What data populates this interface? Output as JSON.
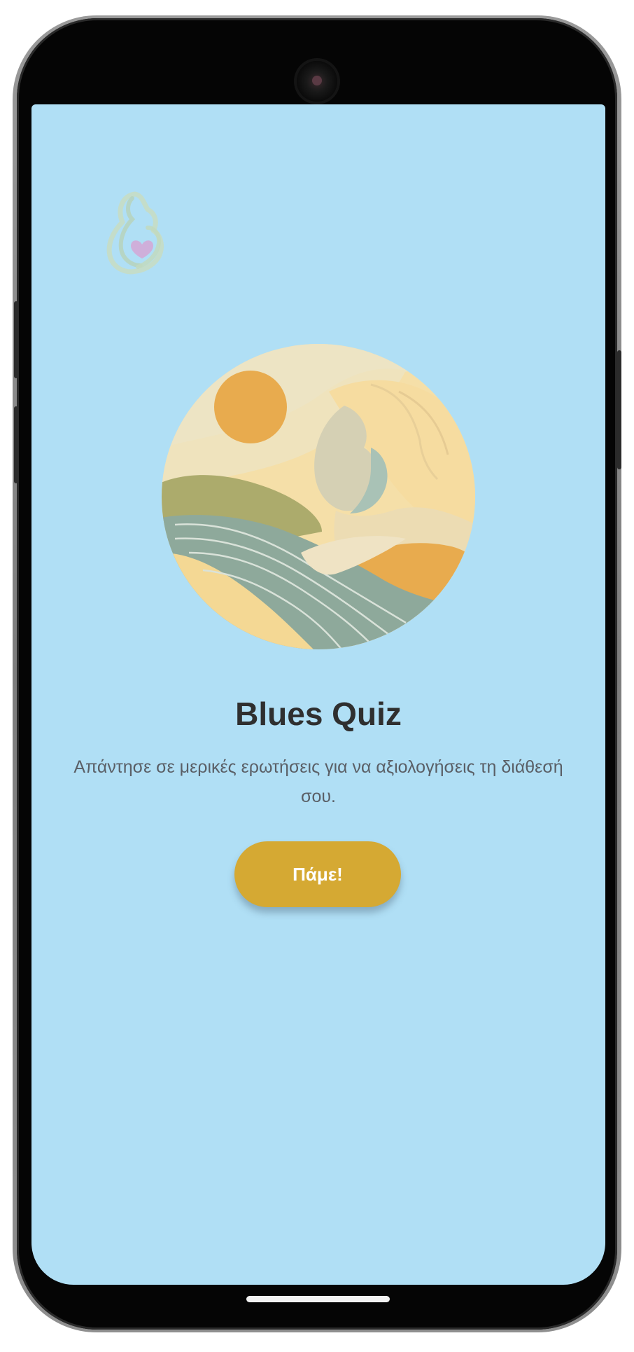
{
  "screen": {
    "background_color": "#b0dff5",
    "logo": {
      "icon": "mother-heart-logo-icon"
    },
    "illustration": {
      "icon": "landscape-sun-woman-illustration"
    },
    "title": "Blues Quiz",
    "subtitle": "Απάντησε σε μερικές ερωτήσεις για να αξιολογήσεις τη διάθεσή σου.",
    "start_button": {
      "label": "Πάμε!",
      "color": "#d5a933"
    }
  },
  "device": {
    "frame_color": "#050505",
    "camera_icon": "front-camera-icon",
    "home_indicator": "home-indicator-bar"
  }
}
